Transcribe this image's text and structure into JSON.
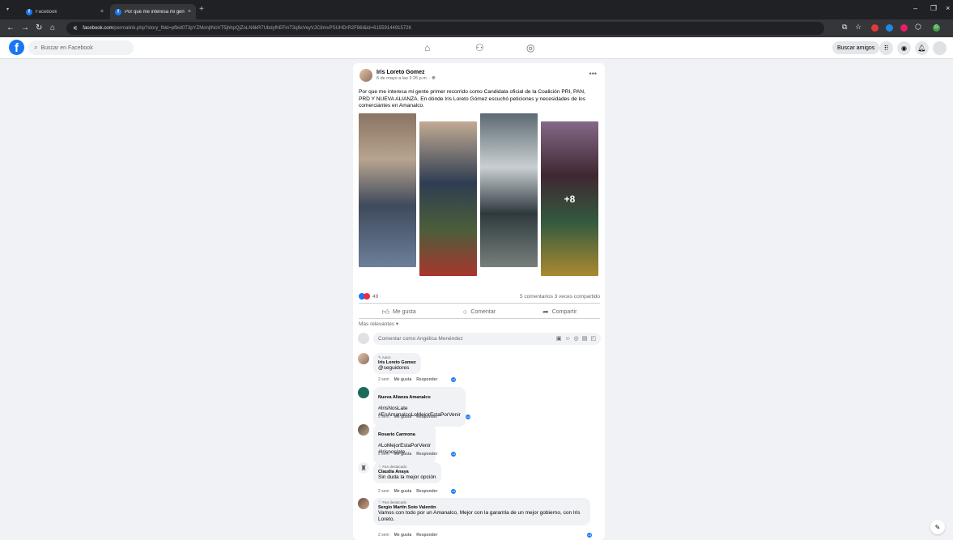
{
  "browser": {
    "tabs": [
      {
        "title": "Facebook",
        "active": false
      },
      {
        "title": "Por que me interesa mi gente p",
        "active": true
      }
    ],
    "url_host": "facebook.com",
    "url_path": "/permalink.php?story_fbid=pfbid0T3pYZMonjtNoVT5jhhpQjZoLN6kR7UbdyfhEFmT3q6xVeyVJC8mvPSUHDrR2F86l&id=61559144915726",
    "profile_initial": "G"
  },
  "facebook": {
    "search_placeholder": "Buscar en Facebook",
    "find_friends": "Buscar amigos"
  },
  "post": {
    "author": "Iris Loreto Gomez",
    "meta": "6 de mayo a las 3:26 p.m. · ",
    "text": "Por que me interesa mi gente primer recorrido como Candidata oficial de la Coalición PRI, PAN, PRD Y NUEVA ALIANZA. En dónde Iris Loreto Gómez escuchó peticiones y necesidades de los comerciantes en Amanalco.",
    "more_photos": "+8",
    "reaction_count": "49",
    "stats": "5 comentarios  3 veces compartido",
    "actions": {
      "like": "Me gusta",
      "comment": "Comentar",
      "share": "Compartir"
    },
    "sort_label": "Más relevantes",
    "composer_placeholder": "Comentar como Angélica Menéndez"
  },
  "comments": [
    {
      "badge": "Autor",
      "name": "Iris Loreto Gomez",
      "text": "@seguidores",
      "time": "2 sem",
      "like": "Me gusta",
      "reply": "Responder"
    },
    {
      "badge": "",
      "name": "Nueva Alianza Amanalco",
      "text": "#IrisNosLate\n#EnAmanalcoLoMejorEstaPorVenir",
      "time": "2 sem",
      "like": "Me gusta",
      "reply": "Responder"
    },
    {
      "badge": "",
      "name": "Rosario Carmona",
      "text": "#LoMejorEstaPorVenir\n#Irisnoslate",
      "time": "2 sem",
      "like": "Me gusta",
      "reply": "Responder"
    },
    {
      "badge": "Fan destacado",
      "name": "Claudia Anaya",
      "text": "Sin duda la mejor opción",
      "time": "2 sem",
      "like": "Me gusta",
      "reply": "Responder"
    },
    {
      "badge": "Fan destacado",
      "name": "Sergio Martín Soto Valentín",
      "text": "Vamos con todo por un Amanalco, Mejor con la garantía de un mejor gobierno, con Iris Loreto.",
      "time": "2 sem",
      "like": "Me gusta",
      "reply": "Responder"
    }
  ],
  "colors": {
    "brand": "#1877f2",
    "chrome_dark": "#202124",
    "chrome_toolbar": "#35363a",
    "page_bg": "#f0f2f5"
  },
  "icons": [
    "tab-list-icon",
    "close-icon",
    "plus-icon",
    "back-icon",
    "forward-icon",
    "reload-icon",
    "home-icon",
    "tune-icon",
    "cast-icon",
    "star-icon",
    "extension-icon",
    "minimize-icon",
    "maximize-icon",
    "window-close-icon",
    "facebook-logo-icon",
    "search-icon",
    "home-nav-icon",
    "friends-icon",
    "groups-icon",
    "grid-menu-icon",
    "messenger-icon",
    "bell-icon",
    "globe-icon",
    "more-icon",
    "like-icon",
    "comment-icon",
    "share-icon",
    "chevron-down-icon",
    "sticker-icon",
    "emoji-icon",
    "camera-icon",
    "gif-icon",
    "pencil-icon",
    "heart-icon",
    "edit-compose-icon"
  ]
}
